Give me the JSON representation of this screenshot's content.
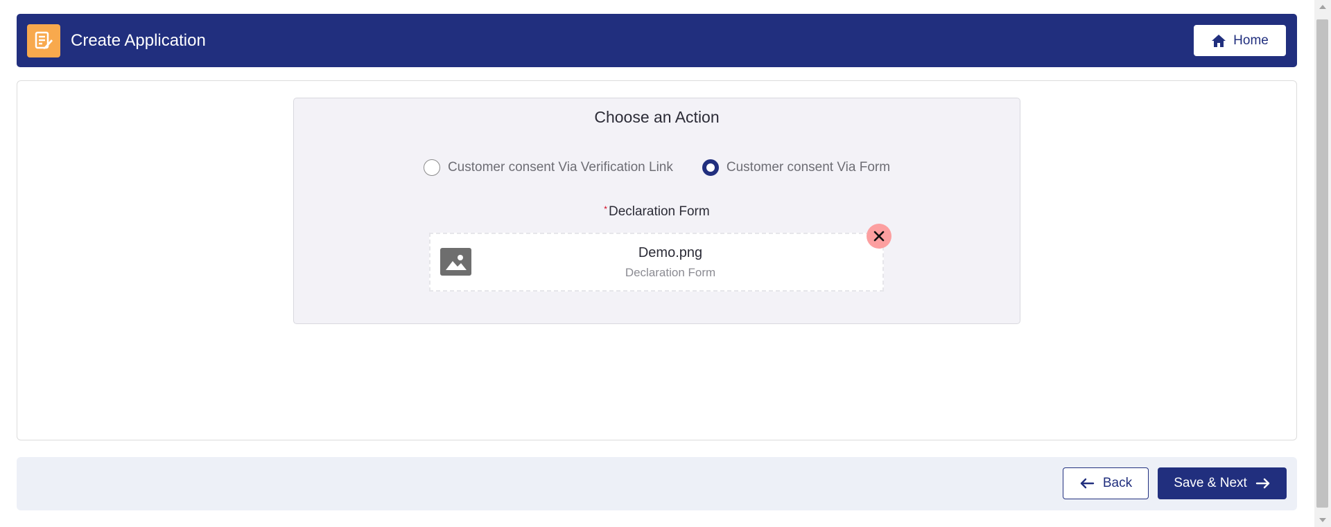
{
  "header": {
    "title": "Create Application",
    "home_label": "Home"
  },
  "panel": {
    "title": "Choose an Action",
    "options": [
      {
        "label": "Customer consent Via Verification Link",
        "selected": false
      },
      {
        "label": "Customer consent Via Form",
        "selected": true
      }
    ],
    "required_mark": "*",
    "field_label": "Declaration Form",
    "file": {
      "name": "Demo.png",
      "description": "Declaration Form"
    }
  },
  "footer": {
    "back_label": "Back",
    "next_label": "Save & Next"
  },
  "colors": {
    "primary": "#212f7e",
    "accent": "#f8a94d",
    "remove": "#fc9fa0"
  }
}
